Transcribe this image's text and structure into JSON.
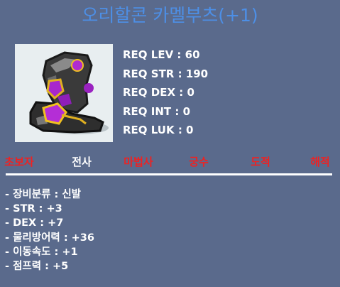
{
  "item": {
    "name": "오리할콘 카멜부츠(+1)",
    "icon": "purple-boots-icon"
  },
  "requirements": [
    "REQ LEV : 60",
    "REQ STR : 190",
    "REQ DEX : 0",
    "REQ INT : 0",
    "REQ LUK : 0"
  ],
  "jobs": [
    {
      "label": "초보자",
      "available": false
    },
    {
      "label": "전사",
      "available": true
    },
    {
      "label": "마법사",
      "available": false
    },
    {
      "label": "궁수",
      "available": false
    },
    {
      "label": "도적",
      "available": false
    },
    {
      "label": "해적",
      "available": false
    }
  ],
  "stats": [
    "- 장비분류 : 신발",
    "- STR : +3",
    "- DEX : +7",
    "- 물리방어력 : +36",
    "- 이동속도 : +1",
    "- 점프력 : +5"
  ],
  "colors": {
    "background": "#5a6a8c",
    "title": "#4d8fe6",
    "job_available": "#ffffff",
    "job_unavailable": "#ee2222"
  }
}
